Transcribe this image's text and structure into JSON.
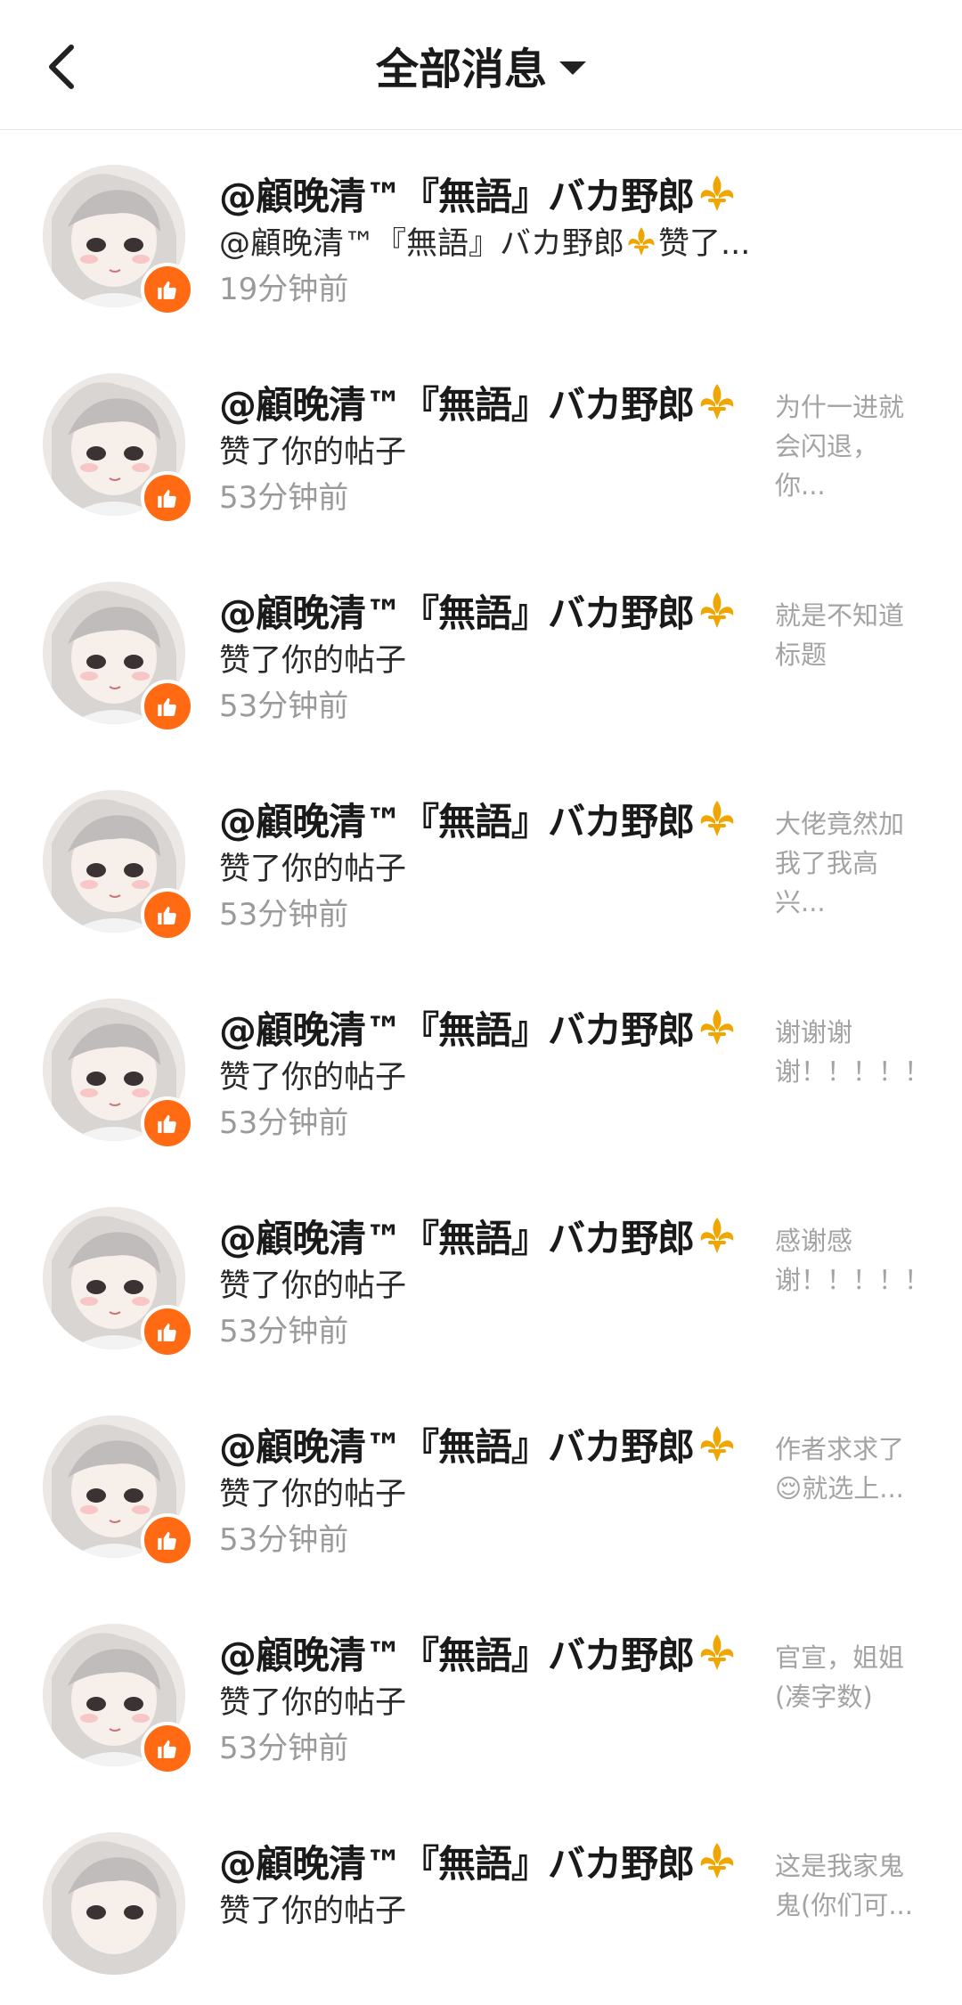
{
  "header": {
    "title": "全部消息"
  },
  "messages": [
    {
      "name": "@顧晚清™『無語』バカ野郎",
      "sub_prefix": "@顧晚清™『無語』バカ野郎",
      "sub_suffix": "赞了...",
      "time": "19分钟前",
      "preview": ""
    },
    {
      "name": "@顧晚清™『無語』バカ野郎",
      "sub": "赞了你的帖子",
      "time": "53分钟前",
      "preview": "为什一进就会闪退，你..."
    },
    {
      "name": "@顧晚清™『無語』バカ野郎",
      "sub": "赞了你的帖子",
      "time": "53分钟前",
      "preview": "就是不知道标题"
    },
    {
      "name": "@顧晚清™『無語』バカ野郎",
      "sub": "赞了你的帖子",
      "time": "53分钟前",
      "preview": "大佬竟然加我了我高兴..."
    },
    {
      "name": "@顧晚清™『無語』バカ野郎",
      "sub": "赞了你的帖子",
      "time": "53分钟前",
      "preview": "谢谢谢谢！！！！！！..."
    },
    {
      "name": "@顧晚清™『無語』バカ野郎",
      "sub": "赞了你的帖子",
      "time": "53分钟前",
      "preview": "感谢感谢！！！！！！..."
    },
    {
      "name": "@顧晚清™『無語』バカ野郎",
      "sub": "赞了你的帖子",
      "time": "53分钟前",
      "preview": "作者求求了😌就选上..."
    },
    {
      "name": "@顧晚清™『無語』バカ野郎",
      "sub": "赞了你的帖子",
      "time": "53分钟前",
      "preview": "官宣，姐姐(凑字数)"
    },
    {
      "name": "@顧晚清™『無語』バカ野郎",
      "sub": "赞了你的帖子",
      "time": "",
      "preview": "这是我家鬼鬼(你们可..."
    }
  ],
  "colors": {
    "accent": "#ff6a13",
    "fleur": "#f0a500",
    "muted": "#9a9a9a"
  },
  "icons": {
    "back": "chevron-left-icon",
    "badge": "thumbs-up-icon",
    "emblem": "fleur-de-lis-icon"
  }
}
